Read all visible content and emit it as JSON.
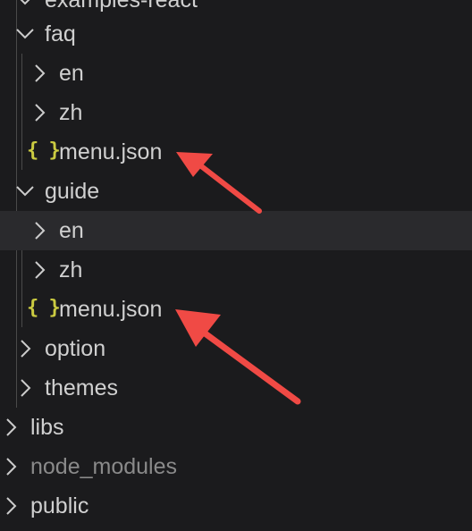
{
  "explorer": {
    "items": [
      {
        "label": "examples-react"
      },
      {
        "label": "faq"
      },
      {
        "label": "en"
      },
      {
        "label": "zh"
      },
      {
        "label": "menu.json",
        "icon": "{ }"
      },
      {
        "label": "guide"
      },
      {
        "label": "en"
      },
      {
        "label": "zh"
      },
      {
        "label": "menu.json",
        "icon": "{ }"
      },
      {
        "label": "option"
      },
      {
        "label": "themes"
      },
      {
        "label": "libs"
      },
      {
        "label": "node_modules"
      },
      {
        "label": "public"
      }
    ]
  },
  "colors": {
    "background": "#1b1b1d",
    "hover_row": "#2a2a2d",
    "json_icon": "#cbcb41",
    "annotation_arrow": "#f04a45"
  }
}
